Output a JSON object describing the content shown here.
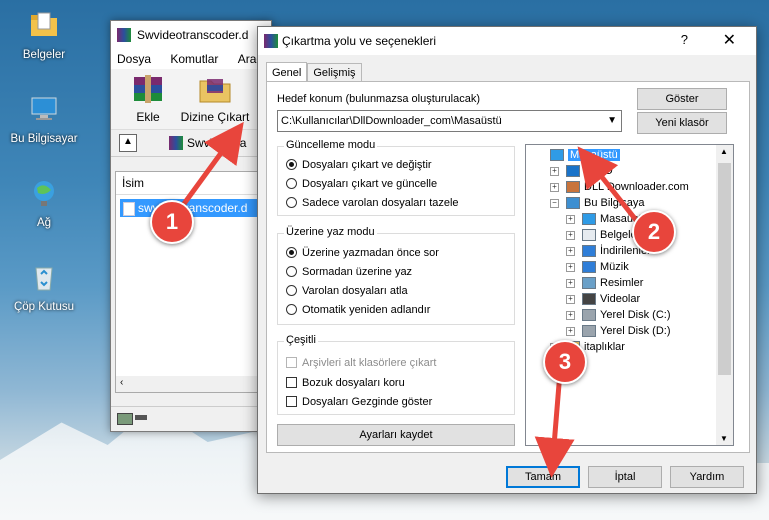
{
  "desktop": {
    "icons": [
      {
        "label": "Belgeler",
        "icon": "folder-documents-icon"
      },
      {
        "label": "Bu Bilgisayar",
        "icon": "computer-icon"
      },
      {
        "label": "Ağ",
        "icon": "network-icon"
      },
      {
        "label": "Çöp Kutusu",
        "icon": "recycle-bin-icon"
      }
    ]
  },
  "winrar": {
    "title": "Swvideotranscoder.d",
    "menu": [
      "Dosya",
      "Komutlar",
      "Araçla"
    ],
    "toolbar": {
      "add_label": "Ekle",
      "extract_label": "Dizine Çıkart"
    },
    "address": "Swvideotra",
    "list_header": "İsim",
    "list_item": "swvideotranscoder.d"
  },
  "dialog": {
    "title": "Çıkartma yolu ve seçenekleri",
    "help_glyph": "?",
    "close_glyph": "✕",
    "tabs": [
      "Genel",
      "Gelişmiş"
    ],
    "dest_label": "Hedef konum (bulunmazsa oluşturulacak)",
    "dest_value": "C:\\Kullanıcılar\\DllDownloader_com\\Masaüstü",
    "show_button": "Göster",
    "new_folder_button": "Yeni klasör",
    "update_mode": {
      "title": "Güncelleme modu",
      "options": [
        "Dosyaları çıkart ve değiştir",
        "Dosyaları çıkart ve güncelle",
        "Sadece varolan dosyaları tazele"
      ],
      "selected": 0
    },
    "overwrite_mode": {
      "title": "Üzerine yaz modu",
      "options": [
        "Üzerine yazmadan önce sor",
        "Sormadan üzerine yaz",
        "Varolan dosyaları atla",
        "Otomatik yeniden adlandır"
      ],
      "selected": 0
    },
    "misc": {
      "title": "Çeşitli",
      "options": [
        {
          "label": "Arşivleri alt klasörlere çıkart",
          "checked": false,
          "disabled": true
        },
        {
          "label": "Bozuk dosyaları koru",
          "checked": false,
          "disabled": false
        },
        {
          "label": "Dosyaları Gezginde göster",
          "checked": false,
          "disabled": false
        }
      ]
    },
    "save_settings_button": "Ayarları kaydet",
    "tree": [
      {
        "label": "Masaüstü",
        "icon": "desktop-folder-icon",
        "level": 0,
        "selected": true,
        "expander": ""
      },
      {
        "label": "OneD",
        "icon": "onedrive-icon",
        "level": 1,
        "expander": "+"
      },
      {
        "label": "DLL Downloader.com",
        "icon": "user-icon",
        "level": 1,
        "expander": "+"
      },
      {
        "label": "Bu Bilgisaya",
        "icon": "computer-icon",
        "level": 1,
        "expander": "−"
      },
      {
        "label": "Masaüstü",
        "icon": "desktop-folder-icon",
        "level": 2,
        "expander": "+"
      },
      {
        "label": "Belgeler",
        "icon": "documents-icon",
        "level": 2,
        "expander": "+"
      },
      {
        "label": "İndirilenler",
        "icon": "downloads-icon",
        "level": 2,
        "expander": "+"
      },
      {
        "label": "Müzik",
        "icon": "music-icon",
        "level": 2,
        "expander": "+"
      },
      {
        "label": "Resimler",
        "icon": "pictures-icon",
        "level": 2,
        "expander": "+"
      },
      {
        "label": "Videolar",
        "icon": "videos-icon",
        "level": 2,
        "expander": "+"
      },
      {
        "label": "Yerel Disk (C:)",
        "icon": "drive-icon",
        "level": 2,
        "expander": "+"
      },
      {
        "label": "Yerel Disk (D:)",
        "icon": "drive-icon",
        "level": 2,
        "expander": "+"
      },
      {
        "label": "itaplıklar",
        "icon": "libraries-icon",
        "level": 1,
        "expander": "+"
      },
      {
        "label": "",
        "icon": "network-icon",
        "level": 1,
        "expander": "+"
      }
    ],
    "ok_button": "Tamam",
    "cancel_button": "İptal",
    "help_button": "Yardım"
  },
  "annotations": [
    "1",
    "2",
    "3"
  ],
  "colors": {
    "accent": "#0078d7",
    "selection": "#3399ff",
    "badge": "#e8453c"
  }
}
